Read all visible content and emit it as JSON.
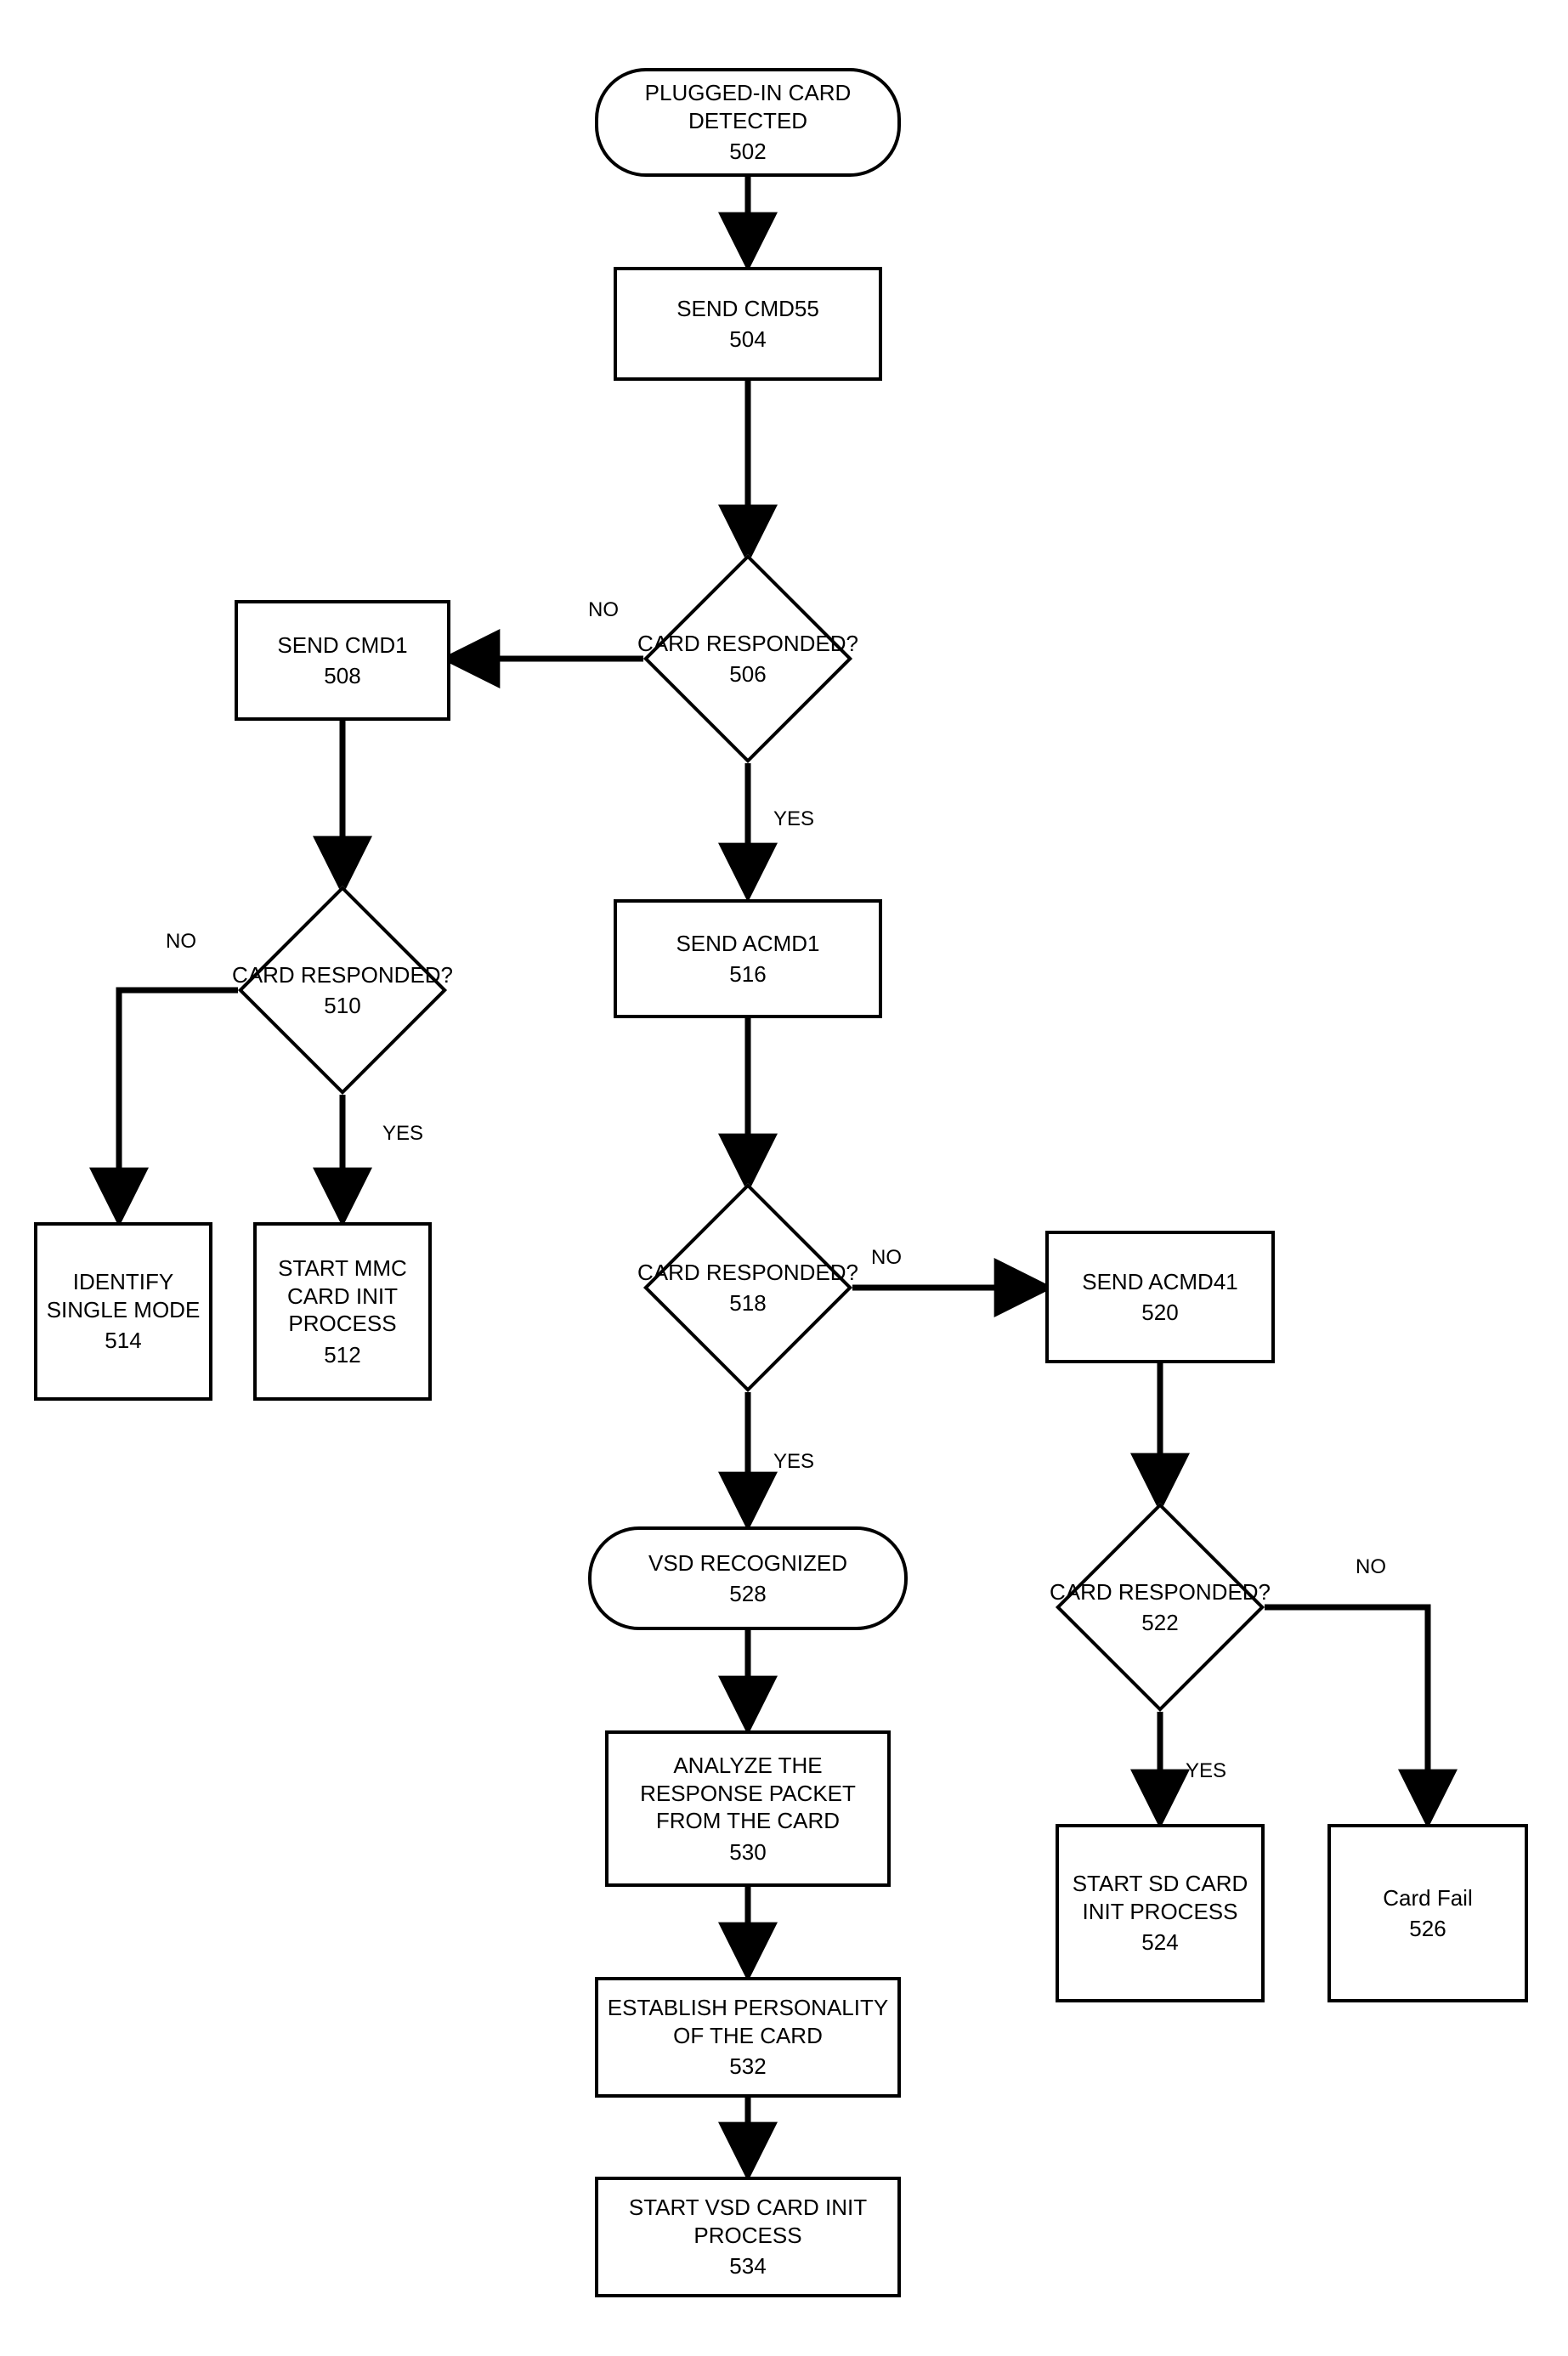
{
  "chart_data": {
    "type": "flowchart",
    "nodes": [
      {
        "id": "502",
        "shape": "terminator",
        "text": "PLUGGED-IN CARD DETECTED"
      },
      {
        "id": "504",
        "shape": "process",
        "text": "SEND CMD55"
      },
      {
        "id": "506",
        "shape": "decision",
        "text": "CARD RESPONDED?"
      },
      {
        "id": "508",
        "shape": "process",
        "text": "SEND CMD1"
      },
      {
        "id": "510",
        "shape": "decision",
        "text": "CARD RESPONDED?"
      },
      {
        "id": "512",
        "shape": "process",
        "text": "START MMC CARD INIT PROCESS"
      },
      {
        "id": "514",
        "shape": "process",
        "text": "IDENTIFY SINGLE MODE"
      },
      {
        "id": "516",
        "shape": "process",
        "text": "SEND ACMD1"
      },
      {
        "id": "518",
        "shape": "decision",
        "text": "CARD RESPONDED?"
      },
      {
        "id": "520",
        "shape": "process",
        "text": "SEND ACMD41"
      },
      {
        "id": "522",
        "shape": "decision",
        "text": "CARD RESPONDED?"
      },
      {
        "id": "524",
        "shape": "process",
        "text": "START SD CARD INIT PROCESS"
      },
      {
        "id": "526",
        "shape": "process",
        "text": "Card Fail"
      },
      {
        "id": "528",
        "shape": "terminator",
        "text": "VSD RECOGNIZED"
      },
      {
        "id": "530",
        "shape": "process",
        "text": "ANALYZE THE RESPONSE PACKET FROM THE CARD"
      },
      {
        "id": "532",
        "shape": "process",
        "text": "ESTABLISH PERSONALITY OF THE CARD"
      },
      {
        "id": "534",
        "shape": "process",
        "text": "START VSD CARD INIT PROCESS"
      }
    ],
    "edges": [
      {
        "from": "502",
        "to": "504"
      },
      {
        "from": "504",
        "to": "506"
      },
      {
        "from": "506",
        "to": "508",
        "label": "NO"
      },
      {
        "from": "506",
        "to": "516",
        "label": "YES"
      },
      {
        "from": "508",
        "to": "510"
      },
      {
        "from": "510",
        "to": "514",
        "label": "NO"
      },
      {
        "from": "510",
        "to": "512",
        "label": "YES"
      },
      {
        "from": "516",
        "to": "518"
      },
      {
        "from": "518",
        "to": "528",
        "label": "YES"
      },
      {
        "from": "518",
        "to": "520",
        "label": "NO"
      },
      {
        "from": "520",
        "to": "522"
      },
      {
        "from": "522",
        "to": "524",
        "label": "YES"
      },
      {
        "from": "522",
        "to": "526",
        "label": "NO"
      },
      {
        "from": "528",
        "to": "530"
      },
      {
        "from": "530",
        "to": "532"
      },
      {
        "from": "532",
        "to": "534"
      }
    ]
  },
  "nodes": {
    "n502": {
      "line1": "PLUGGED-IN CARD",
      "line2": "DETECTED",
      "id": "502"
    },
    "n504": {
      "line1": "SEND CMD55",
      "id": "504"
    },
    "n506": {
      "line1": "CARD RESPONDED?",
      "id": "506"
    },
    "n508": {
      "line1": "SEND CMD1",
      "id": "508"
    },
    "n510": {
      "line1": "CARD RESPONDED?",
      "id": "510"
    },
    "n512": {
      "line1": "START MMC",
      "line2": "CARD INIT",
      "line3": "PROCESS",
      "id": "512"
    },
    "n514": {
      "line1": "IDENTIFY",
      "line2": "SINGLE MODE",
      "id": "514"
    },
    "n516": {
      "line1": "SEND ACMD1",
      "id": "516"
    },
    "n518": {
      "line1": "CARD RESPONDED?",
      "id": "518"
    },
    "n520": {
      "line1": "SEND ACMD41",
      "id": "520"
    },
    "n522": {
      "line1": "CARD RESPONDED?",
      "id": "522"
    },
    "n524": {
      "line1": "START SD CARD",
      "line2": "INIT PROCESS",
      "id": "524"
    },
    "n526": {
      "line1": "Card Fail",
      "id": "526"
    },
    "n528": {
      "line1": "VSD RECOGNIZED",
      "id": "528"
    },
    "n530": {
      "line1": "ANALYZE THE",
      "line2": "RESPONSE PACKET",
      "line3": "FROM THE CARD",
      "id": "530"
    },
    "n532": {
      "line1": "ESTABLISH PERSONALITY",
      "line2": "OF THE CARD",
      "id": "532"
    },
    "n534": {
      "line1": "START VSD CARD INIT",
      "line2": "PROCESS",
      "id": "534"
    }
  },
  "labels": {
    "no": "NO",
    "yes": "YES"
  }
}
